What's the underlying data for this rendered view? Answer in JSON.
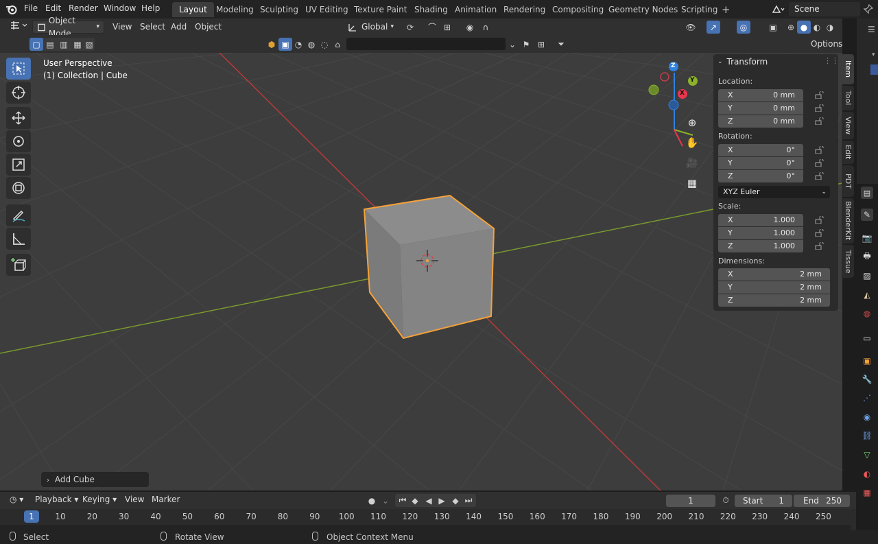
{
  "menu": {
    "items": [
      "File",
      "Edit",
      "Render",
      "Window",
      "Help"
    ]
  },
  "workspaces": {
    "tabs": [
      "Layout",
      "Modeling",
      "Sculpting",
      "UV Editing",
      "Texture Paint",
      "Shading",
      "Animation",
      "Rendering",
      "Compositing",
      "Geometry Nodes",
      "Scripting"
    ],
    "active": "Layout",
    "add_symbol": "+"
  },
  "scene": {
    "name": "Scene"
  },
  "header": {
    "mode": "Object Mode",
    "view": "View",
    "select": "Select",
    "add": "Add",
    "object": "Object",
    "transform_orientation": "Global",
    "options": "Options"
  },
  "viewport": {
    "perspective_label": "User Perspective",
    "collection_label": "(1) Collection | Cube",
    "gizmo_axes": {
      "x": "X",
      "y": "Y",
      "z": "Z"
    },
    "colors": {
      "x_axis": "#b83a3a",
      "y_axis": "#7a9a2c",
      "selection": "#f5a23a",
      "z_gizmo": "#2f82e0",
      "x_gizmo": "#e8364f",
      "y_gizmo": "#8bb22a"
    }
  },
  "sidebar": {
    "panel_title": "Transform",
    "location": {
      "label": "Location:",
      "x": {
        "axis": "X",
        "value": "0 mm"
      },
      "y": {
        "axis": "Y",
        "value": "0 mm"
      },
      "z": {
        "axis": "Z",
        "value": "0 mm"
      }
    },
    "rotation": {
      "label": "Rotation:",
      "x": {
        "axis": "X",
        "value": "0°"
      },
      "y": {
        "axis": "Y",
        "value": "0°"
      },
      "z": {
        "axis": "Z",
        "value": "0°"
      },
      "mode": "XYZ Euler"
    },
    "scale": {
      "label": "Scale:",
      "x": {
        "axis": "X",
        "value": "1.000"
      },
      "y": {
        "axis": "Y",
        "value": "1.000"
      },
      "z": {
        "axis": "Z",
        "value": "1.000"
      }
    },
    "dimensions": {
      "label": "Dimensions:",
      "x": {
        "axis": "X",
        "value": "2 mm"
      },
      "y": {
        "axis": "Y",
        "value": "2 mm"
      },
      "z": {
        "axis": "Z",
        "value": "2 mm"
      }
    },
    "tabs": [
      "Item",
      "Tool",
      "View",
      "Edit",
      "PDT",
      "BlenderKit",
      "Tissue"
    ]
  },
  "operator_panel": {
    "label": "Add Cube"
  },
  "timeline": {
    "playback": "Playback",
    "keying": "Keying",
    "view": "View",
    "marker": "Marker",
    "current_frame": "1",
    "start_label": "Start",
    "start_value": "1",
    "end_label": "End",
    "end_value": "250",
    "ruler": [
      "1",
      "10",
      "20",
      "30",
      "40",
      "50",
      "60",
      "70",
      "80",
      "90",
      "100",
      "110",
      "120",
      "130",
      "140",
      "150",
      "160",
      "170",
      "180",
      "190",
      "200",
      "210",
      "220",
      "230",
      "240",
      "250"
    ]
  },
  "statusbar": {
    "select": "Select",
    "rotate_view": "Rotate View",
    "context_menu": "Object Context Menu"
  }
}
